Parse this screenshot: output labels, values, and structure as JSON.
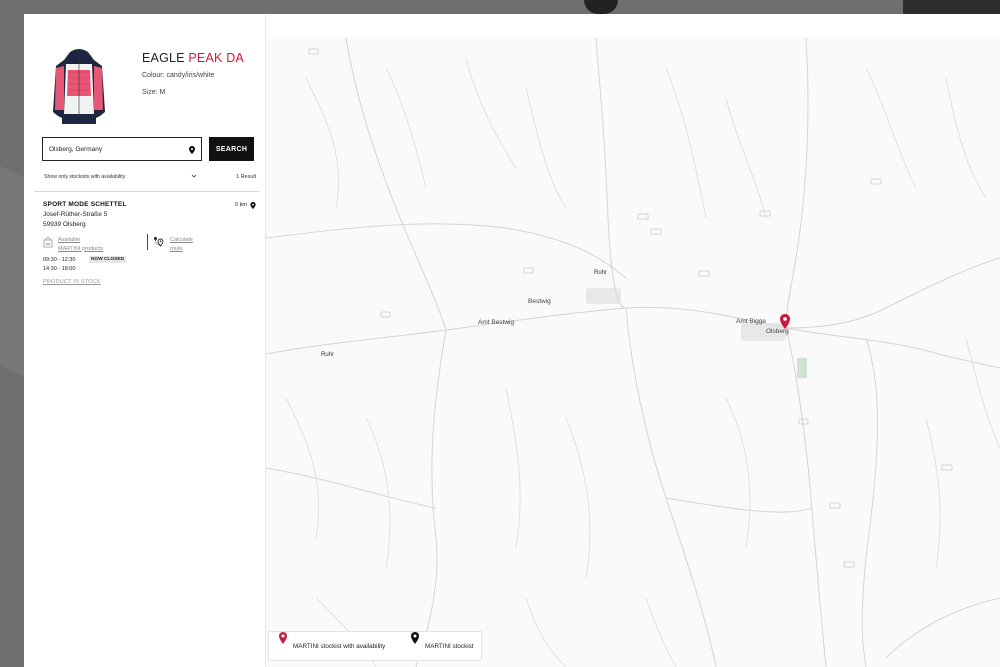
{
  "product": {
    "title_part1": "EAGLE ",
    "title_part2": "PEAK DA",
    "colour": "Colour: candy/iris/white",
    "size": "Size: M"
  },
  "search": {
    "value": "Olsberg, Germany",
    "button_label": "SEARCH"
  },
  "filter": {
    "label": "Show only stockists with availability",
    "results": "1 Result"
  },
  "store": {
    "name": "SPORT MODE SCHETTEL",
    "distance": "0 km",
    "street": "Josef-Rüther-Straße 5",
    "city": "59939 Olsberg",
    "availability_line1": "Available",
    "availability_line2": "MARTINI products",
    "route_line1": "Calculate",
    "route_line2": "route",
    "hours_row1": "09:30   -   12:30",
    "hours_row2": "14:30   -   18:00",
    "status_badge": "NOW CLOSED",
    "stock_link": "PRODUCT IN STOCK"
  },
  "map": {
    "labels": {
      "bestwig": "Bestwig",
      "amt_bestwig": "Amt Bestwig",
      "amt_bigge": "Amt Bigge",
      "olsberg": "Olsberg",
      "ruhr_left": "Ruhr",
      "ruhr_mid": "Ruhr"
    },
    "legend": {
      "with_availability": "MARTINI stockist with availability",
      "stockist": "MARTINI stockist"
    }
  },
  "colors": {
    "accent": "#c81d3a",
    "button": "#111111",
    "map_bg": "#fafafa",
    "road": "#cfcfcf"
  },
  "icons": [
    "location-pin-icon",
    "chevron-down-icon",
    "store-bag-icon",
    "route-icon",
    "map-marker-icon"
  ]
}
